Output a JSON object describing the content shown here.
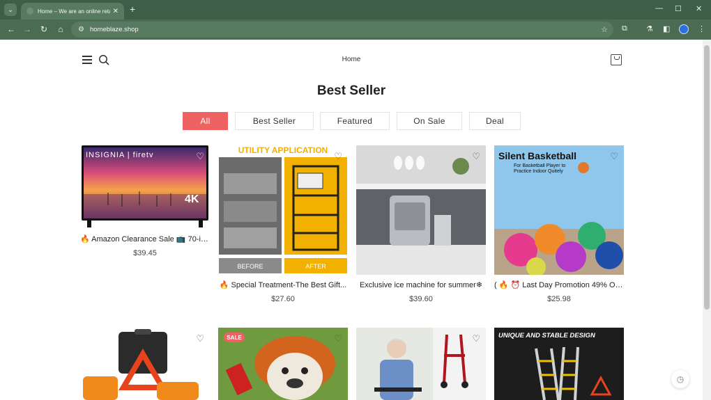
{
  "browser": {
    "tab_title": "Home – We are an online retai",
    "url": "homeblaze.shop"
  },
  "header": {
    "nav_home": "Home"
  },
  "section": {
    "title": "Best Seller",
    "filters": [
      "All",
      "Best Seller",
      "Featured",
      "On Sale",
      "Deal"
    ]
  },
  "products": [
    {
      "title": "🔥 Amazon Clearance Sale 📺 70-in...",
      "price": "$39.45",
      "image_text": "INSIGNIA | firetv",
      "badge_text": "4K"
    },
    {
      "title": "🔥 Special Treatment-The Best Gift...",
      "price": "$27.60",
      "image_text": "UTILITY APPLICATION",
      "before": "BEFORE",
      "after": "AFTER"
    },
    {
      "title": "Exclusive ice machine for summer❄",
      "price": "$39.60"
    },
    {
      "title": "( 🔥 ⏰ Last Day Promotion 49% OF...",
      "price": "$25.98",
      "image_text": "Silent Basketball",
      "image_sub": "For Basketball Player to Practice Indoor Quitely"
    },
    {
      "title": "",
      "price": ""
    },
    {
      "title": "",
      "price": "",
      "badge": "SALE"
    },
    {
      "title": "",
      "price": ""
    },
    {
      "title": "",
      "price": "",
      "image_text": "UNIQUE AND STABLE DESIGN"
    }
  ],
  "colors": {
    "accent": "#ef6262",
    "chrome": "#3f5e47"
  }
}
